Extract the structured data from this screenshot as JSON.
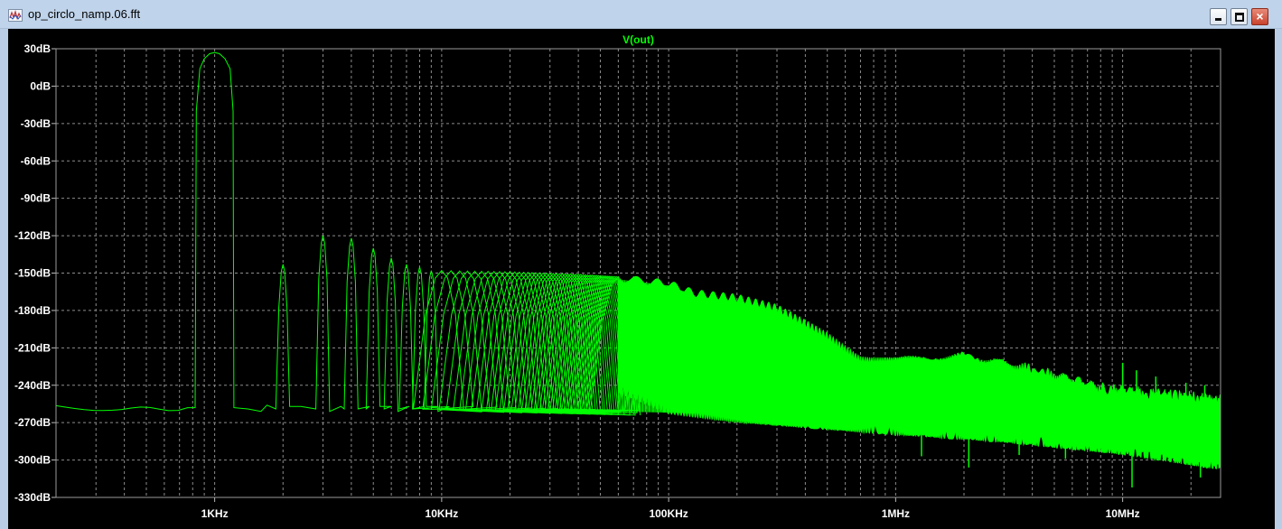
{
  "window": {
    "title": "op_circlo_namp.06.fft",
    "icon": "waveform-icon",
    "buttons": {
      "minimize": "minimize-icon",
      "maximize": "maximize-icon",
      "close": "×"
    }
  },
  "chart_data": {
    "type": "line",
    "title": "V(out)",
    "xlabel": "",
    "ylabel": "",
    "x_scale": "log",
    "xlim": [
      200,
      27000000
    ],
    "ylim": [
      -330,
      30
    ],
    "grid": true,
    "colors": {
      "background": "#000000",
      "grid": "#8c8c8c",
      "trace": "#00ff00",
      "ticks": "#ffffff"
    },
    "x_ticks": [
      {
        "value": 1000,
        "label": "1KHz"
      },
      {
        "value": 10000,
        "label": "10KHz"
      },
      {
        "value": 100000,
        "label": "100KHz"
      },
      {
        "value": 1000000,
        "label": "1MHz"
      },
      {
        "value": 10000000,
        "label": "10MHz"
      }
    ],
    "y_ticks": [
      {
        "value": 30,
        "label": "30dB"
      },
      {
        "value": 0,
        "label": "0dB"
      },
      {
        "value": -30,
        "label": "-30dB"
      },
      {
        "value": -60,
        "label": "-60dB"
      },
      {
        "value": -90,
        "label": "-90dB"
      },
      {
        "value": -120,
        "label": "-120dB"
      },
      {
        "value": -150,
        "label": "-150dB"
      },
      {
        "value": -180,
        "label": "-180dB"
      },
      {
        "value": -210,
        "label": "-210dB"
      },
      {
        "value": -240,
        "label": "-240dB"
      },
      {
        "value": -270,
        "label": "-270dB"
      },
      {
        "value": -300,
        "label": "-300dB"
      },
      {
        "value": -330,
        "label": "-330dB"
      }
    ],
    "series": [
      {
        "fundamental": {
          "freq": 1000,
          "level": 27
        },
        "harmonic_peaks": [
          [
            2000,
            -143
          ],
          [
            3000,
            -120
          ],
          [
            4000,
            -122
          ],
          [
            5000,
            -130
          ],
          [
            6000,
            -138
          ],
          [
            7000,
            -143
          ],
          [
            8000,
            -145
          ],
          [
            9000,
            -148
          ],
          [
            10000,
            -148
          ],
          [
            20000,
            -149
          ],
          [
            40000,
            -151
          ],
          [
            60000,
            -153
          ],
          [
            80000,
            -156
          ],
          [
            100000,
            -159
          ]
        ],
        "noise_floor": [
          [
            200,
            -256
          ],
          [
            400,
            -260
          ],
          [
            800,
            -258
          ],
          [
            10000,
            -258
          ],
          [
            100000,
            -262
          ],
          [
            1000000,
            -268
          ],
          [
            10000000,
            -270
          ],
          [
            27000000,
            -272
          ]
        ],
        "envelope_upper": [
          [
            60000,
            -155
          ],
          [
            100000,
            -160
          ],
          [
            130000,
            -168
          ],
          [
            200000,
            -172
          ],
          [
            300000,
            -180
          ],
          [
            500000,
            -200
          ],
          [
            700000,
            -218
          ],
          [
            1000000,
            -222
          ],
          [
            2000000,
            -218
          ],
          [
            4000000,
            -228
          ],
          [
            8000000,
            -243
          ],
          [
            27000000,
            -252
          ]
        ],
        "envelope_lower": [
          [
            60000,
            -238
          ],
          [
            100000,
            -255
          ],
          [
            200000,
            -262
          ],
          [
            500000,
            -268
          ],
          [
            1000000,
            -272
          ],
          [
            3000000,
            -278
          ],
          [
            10000000,
            -288
          ],
          [
            27000000,
            -300
          ]
        ],
        "spikes_down": [
          [
            1300000,
            -297
          ],
          [
            2100000,
            -306
          ],
          [
            3500000,
            -296
          ],
          [
            5600000,
            -299
          ],
          [
            11000000,
            -322
          ],
          [
            22000000,
            -314
          ]
        ],
        "spikes_up": [
          [
            10000000,
            -222
          ],
          [
            11500000,
            -228
          ],
          [
            14000000,
            -233
          ],
          [
            19000000,
            -238
          ],
          [
            23000000,
            -240
          ]
        ]
      }
    ]
  }
}
